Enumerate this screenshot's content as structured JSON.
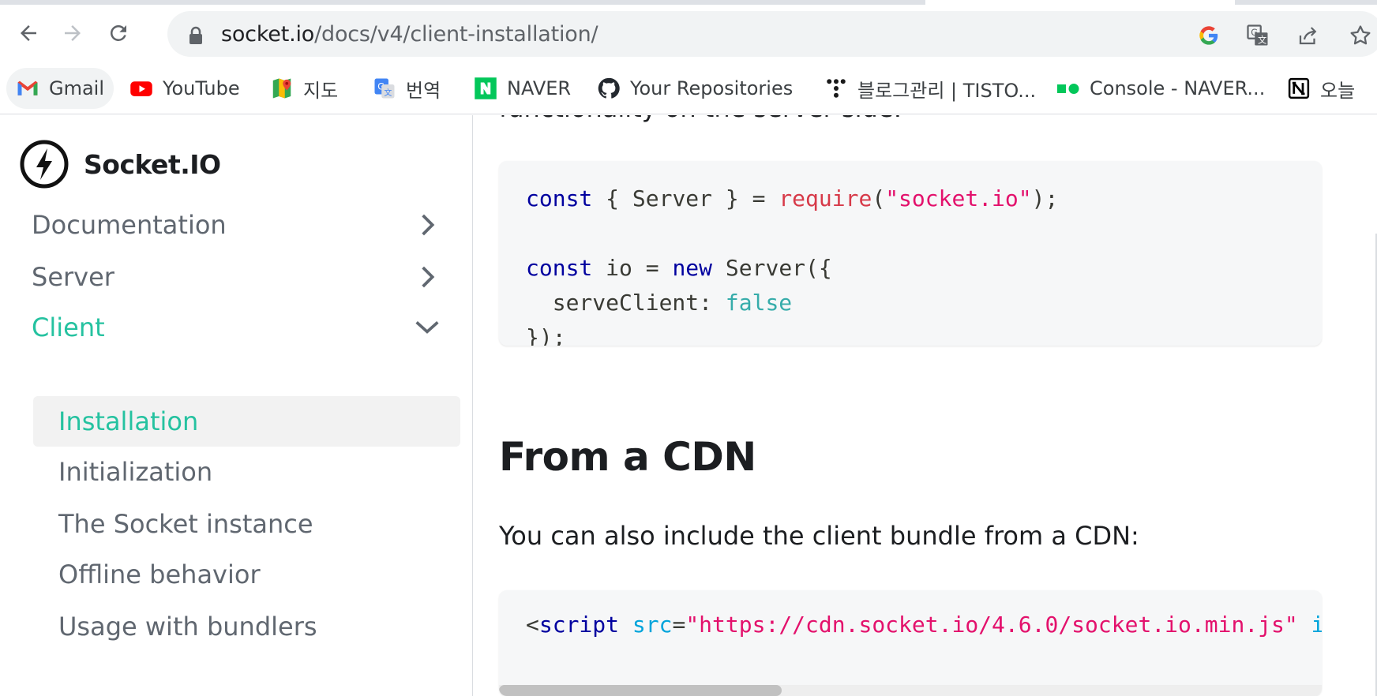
{
  "browser": {
    "url_host": "socket.io",
    "url_path": "/docs/v4/client-installation/"
  },
  "bookmarks": [
    {
      "label": "Gmail",
      "icon": "gmail-icon"
    },
    {
      "label": "YouTube",
      "icon": "youtube-icon"
    },
    {
      "label": "지도",
      "icon": "google-maps-icon"
    },
    {
      "label": "번역",
      "icon": "google-translate-icon"
    },
    {
      "label": "NAVER",
      "icon": "naver-icon"
    },
    {
      "label": "Your Repositories",
      "icon": "github-icon"
    },
    {
      "label": "블로그관리 | TISTO...",
      "icon": "tistory-icon"
    },
    {
      "label": "Console - NAVER...",
      "icon": "naver-cloud-icon"
    },
    {
      "label": "오늘",
      "icon": "notion-icon"
    }
  ],
  "sidebar": {
    "brand": "Socket.IO",
    "categories": [
      {
        "label": "Documentation",
        "state": "collapsed"
      },
      {
        "label": "Server",
        "state": "collapsed"
      },
      {
        "label": "Client",
        "state": "expanded"
      }
    ],
    "client_items": [
      {
        "label": "Installation"
      },
      {
        "label": "Initialization"
      },
      {
        "label": "The Socket instance"
      },
      {
        "label": "Offline behavior"
      },
      {
        "label": "Usage with bundlers"
      }
    ]
  },
  "content": {
    "cut_text": "functionality on the server side:",
    "code1": {
      "l1_const": "const",
      "l1_mid": " { Server } = ",
      "l1_fn": "require",
      "l1_open": "(",
      "l1_str": "\"socket.io\"",
      "l1_close": ");",
      "l3_const": "const",
      "l3_mid": " io = ",
      "l3_new": "new",
      "l3_end": " Server({",
      "l4_key": "  serveClient: ",
      "l4_bool": "false",
      "l5": "});"
    },
    "heading": "From a CDN",
    "paragraph": "You can also include the client bundle from a CDN:",
    "code2": {
      "lt": "<",
      "tag": "script",
      "sp": " ",
      "attr": "src",
      "eq": "=",
      "url": "\"https://cdn.socket.io/4.6.0/socket.io.min.js\"",
      "tail_sp": " ",
      "tail": "i"
    }
  },
  "colors": {
    "accent": "#25c2a0",
    "keyword": "#00009f",
    "string": "#e3116c",
    "boolean": "#36acaa"
  }
}
